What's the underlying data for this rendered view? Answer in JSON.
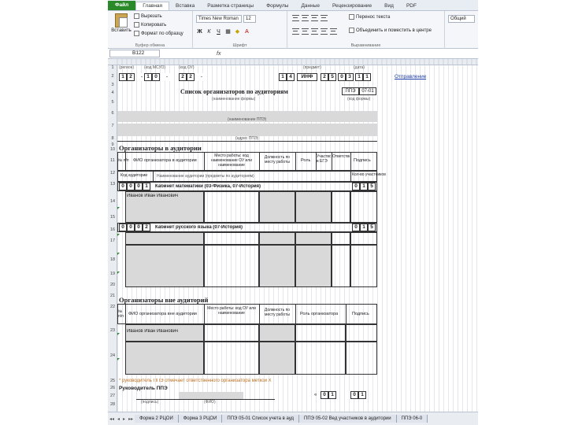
{
  "ribbon": {
    "tabs": [
      "Файл",
      "Главная",
      "Вставка",
      "Разметка страницы",
      "Формулы",
      "Данные",
      "Рецензирование",
      "Вид",
      "PDF"
    ],
    "active_tab": "Главная",
    "clipboard": {
      "paste_label": "Вставить",
      "cut": "Вырезать",
      "copy": "Копировать",
      "format_painter": "Формат по образцу",
      "group_label": "Буфер обмена"
    },
    "font": {
      "family": "Times New Roman",
      "size": "12",
      "group_label": "Шрифт"
    },
    "alignment": {
      "wrap_text": "Перенос текста",
      "merge_center": "Объединить и поместить в центре",
      "group_label": "Выравнивание"
    },
    "number_format": "Общий"
  },
  "formula_bar": {
    "name_box": "B122",
    "fx": "fx"
  },
  "row_numbers": [
    "1",
    "2",
    "3",
    "4",
    "5",
    "6",
    "7",
    "8",
    "9",
    "10",
    "11",
    "12",
    "13",
    "14",
    "15",
    "16",
    "17",
    "18",
    "19",
    "20",
    "21",
    "22",
    "23",
    "24",
    "25",
    "26",
    "27",
    "28"
  ],
  "sheet": {
    "header_labels": {
      "region": "(регион)",
      "code_mouo": "(код МСУО)",
      "code_ou": "(код ОУ)",
      "subject": "(предмет)",
      "date": "(дата)"
    },
    "row2_digits_left": [
      "1",
      "2",
      ".",
      "1",
      "0",
      ".",
      "2",
      "2",
      "."
    ],
    "row2_digits_right": [
      "1",
      "4",
      "ИНФ",
      "2",
      "5",
      "0",
      "3",
      "1",
      "1"
    ],
    "return_link": "Отправление",
    "doc_title": "Список организаторов по аудиториям",
    "form_code": "ППЭ",
    "form_number": "07-01",
    "code_form_label": "(наименование формы)",
    "form_name_label": "(код формы)",
    "ppe_name_label": "(наименование ППЭ)",
    "address_label": "(адрес ППЭ)",
    "section1_title": "Организаторы в аудитории",
    "table1_headers": {
      "num": "№ п/п",
      "fio": "ФИО организатора в аудитории",
      "workplace": "Место работы: код наименование ОУ или наименование",
      "position": "Должность по месту работы",
      "role": "Роль",
      "participant": "Участвовал в ЕГЭ",
      "responsible": "Ответственный",
      "signature": "Подпись"
    },
    "aud_code_label": "Код аудитории",
    "aud_name_label": "Наименование аудитории (предметы по аудиториям)",
    "participants_label": "Кол-во участников",
    "aud1_digits": [
      "0",
      "0",
      "0",
      "1"
    ],
    "aud1_name": "Кабинет математики (03-Физика, 07-История)",
    "aud1_count": [
      "0",
      "1",
      "5"
    ],
    "org1_name": "Иванов Иван Иванович",
    "aud2_digits": [
      "0",
      "0",
      "0",
      "2"
    ],
    "aud2_name": "Кабинет русского языка (07-История)",
    "aud2_count": [
      "0",
      "1",
      "5"
    ],
    "section2_title": "Организаторы вне аудиторий",
    "table2_headers": {
      "num": "№ п/п",
      "fio": "ФИО организатора вне аудитории",
      "workplace": "Место работы: код ОУ или наименование",
      "position": "Должность по месту работы",
      "role": "Роль организатора",
      "signature": "Подпись"
    },
    "org2_name": "Иванов Иван Иванович",
    "footnote": "* руководитель ППЭ отмечает ответственного организатора меткой X",
    "head_label": "Руководитель ППЭ",
    "sign_label": "(подпись)",
    "fio_label": "(ФИО)",
    "date_prefix": "«",
    "date_value": [
      "0",
      "1"
    ],
    "date_value2": [
      "0",
      "1"
    ]
  },
  "sheet_tabs": [
    "Форма 2 РЦОИ",
    "Форма 3 РЦОИ",
    "ППЭ 05-01 Список учета в ауд",
    "ППЭ 05-02 Вед участников в аудитории",
    "ППЭ 06-0"
  ]
}
